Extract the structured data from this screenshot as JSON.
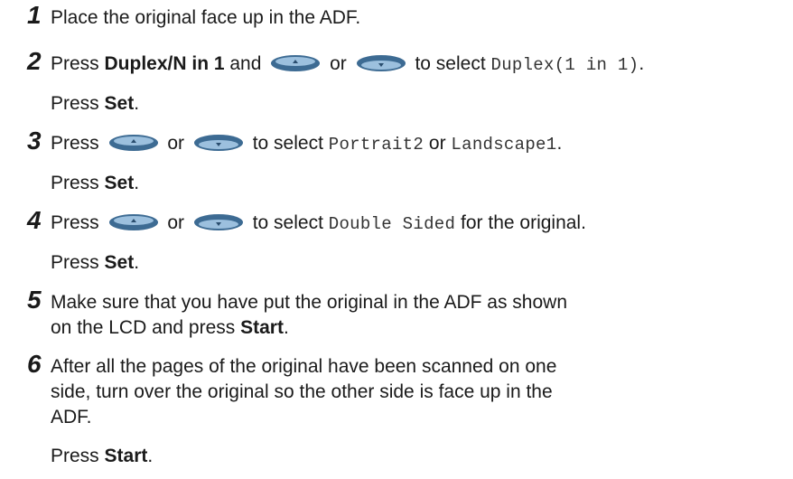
{
  "steps": [
    {
      "num": "1",
      "lines": [
        {
          "t1": "Place the original face up in the ADF."
        }
      ]
    },
    {
      "num": "2",
      "lines": [
        {
          "t1": "Press ",
          "b1": "Duplex/N in 1",
          "t2": " and ",
          "t3": " or ",
          "t4": " to select ",
          "m1": "Duplex(1 in 1)",
          "t5": "."
        },
        {
          "t1": "Press ",
          "b1": "Set",
          "t2": "."
        }
      ]
    },
    {
      "num": "3",
      "lines": [
        {
          "t1": "Press ",
          "t2": " or ",
          "t3": " to select ",
          "m1": "Portrait2",
          "t4": " or ",
          "m2": "Landscape1",
          "t5": "."
        },
        {
          "t1": "Press ",
          "b1": "Set",
          "t2": "."
        }
      ]
    },
    {
      "num": "4",
      "lines": [
        {
          "t1": "Press ",
          "t2": " or ",
          "t3": " to select ",
          "m1": "Double Sided",
          "t4": " for the original."
        },
        {
          "t1": "Press ",
          "b1": "Set",
          "t2": "."
        }
      ]
    },
    {
      "num": "5",
      "lines": [
        {
          "t1": "Make sure that you have put the original in the ADF as shown"
        },
        {
          "t1": "on the LCD and press ",
          "b1": "Start",
          "t2": "."
        }
      ]
    },
    {
      "num": "6",
      "lines": [
        {
          "t1": "After all the pages of the original have been scanned on one"
        },
        {
          "t1": "side, turn over the original so the other side is face up in the"
        },
        {
          "t1": "ADF."
        },
        {
          "t1": "Press ",
          "b1": "Start",
          "t2": "."
        }
      ]
    }
  ],
  "icons": {
    "up_key": "up-arrow-key-icon",
    "down_key": "down-arrow-key-icon"
  },
  "colors": {
    "key_body": "#3d6b93",
    "key_highlight": "#9cc0de"
  }
}
